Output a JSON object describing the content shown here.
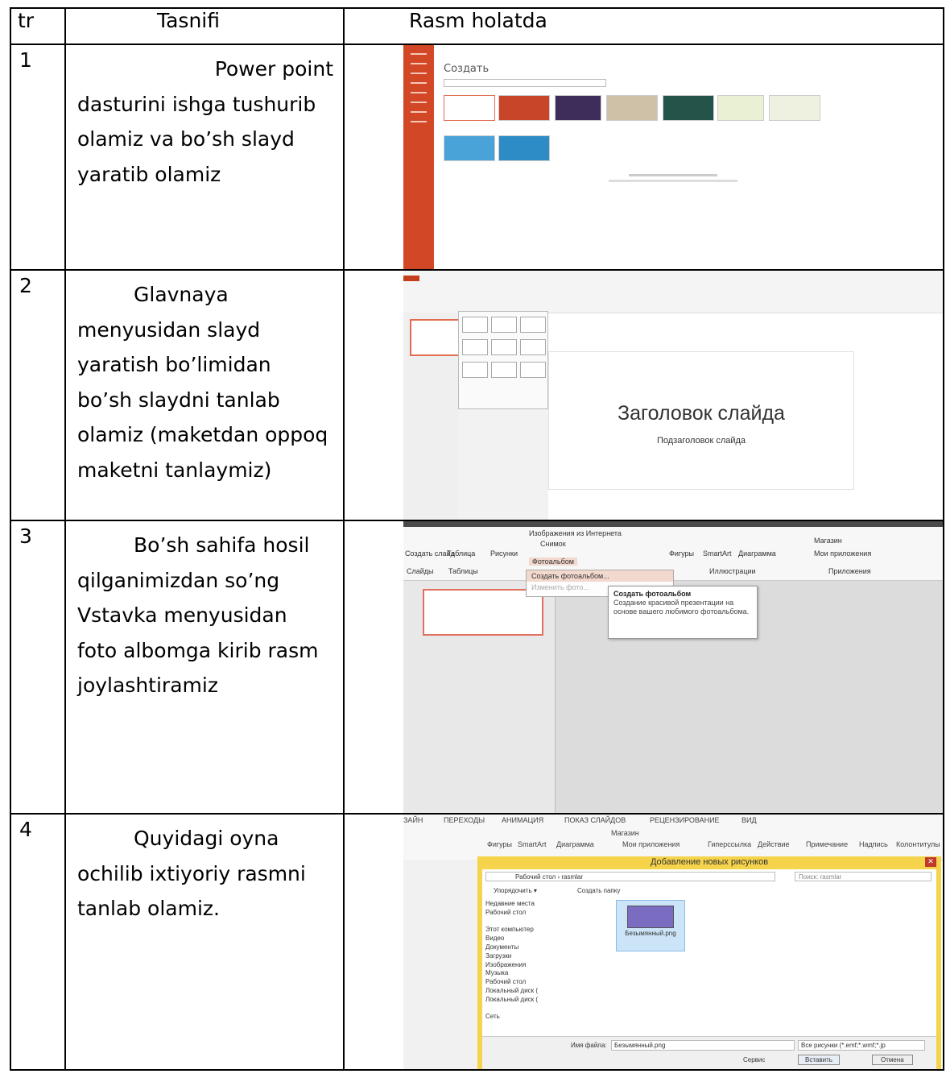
{
  "header": {
    "col_num": "tr",
    "col_desc": "Tasnifi",
    "col_pic": "Rasm holatda"
  },
  "rows": [
    {
      "num": "1",
      "lines": [
        "Power point",
        "dasturini ishga tushurib",
        "olamiz va bo’sh slayd",
        "yaratib olamiz"
      ]
    },
    {
      "num": "2",
      "lines": [
        "Glavnaya",
        "menyusidan slayd",
        "yaratish bo’limidan",
        "bo’sh slaydni tanlab",
        "olamiz (maketdan oppoq",
        "maketni tanlaymiz)"
      ]
    },
    {
      "num": "3",
      "lines": [
        "Bo’sh sahifa hosil",
        "qilganimizdan so’ng",
        "Vstavka menyusidan",
        "foto albomga kirib rasm",
        "joylashtiramiz"
      ]
    },
    {
      "num": "4",
      "lines": [
        "Quyidagi oyna",
        "ochilib ixtiyoriy rasmni",
        "tanlab olamiz."
      ]
    }
  ],
  "shots": {
    "s1": {
      "title": "Создать"
    },
    "s2": {
      "slide_title": "Заголовок слайда",
      "slide_subtitle": "Подзаголовок слайда"
    },
    "s3": {
      "ribbon": [
        "Изображения из Интернета",
        "Снимок",
        "Фотоальбом",
        "Фигуры",
        "SmartArt",
        "Диаграмма",
        "Магазин",
        "Мои приложения",
        "Создать слайд",
        "Таблица",
        "Рисунки",
        "Слайды",
        "Таблицы",
        "Иллюстрации",
        "Приложения"
      ],
      "menu": [
        "Создать фотоальбом...",
        "Изменить фото..."
      ],
      "tooltip_title": "Создать фотоальбом",
      "tooltip_text": "Создание красивой презентации на основе вашего любимого фотоальбома."
    },
    "s4": {
      "ribbon": [
        "ЗАЙН",
        "ПЕРЕХОДЫ",
        "АНИМАЦИЯ",
        "ПОКАЗ СЛАЙДОВ",
        "РЕЦЕНЗИРОВАНИЕ",
        "ВИД",
        "Фигуры",
        "SmartArt",
        "Диаграмма",
        "Магазин",
        "Мои приложения",
        "Гиперссылка",
        "Действие",
        "Примечание",
        "Надпись",
        "Колонтитулы"
      ],
      "caption": "Добавление новых рисунков",
      "address": "Рабочий стол › rasmlar",
      "search": "Поиск: rasmlar",
      "organize": "Упорядочить ▾",
      "new_folder": "Создать папку",
      "tree": [
        "Недавние места",
        "Рабочий стол",
        "",
        "Этот компьютер",
        "Видео",
        "Документы",
        "Загрузки",
        "Изображения",
        "Музыка",
        "Рабочий стол",
        "Локальный диск (",
        "Локальный диск (",
        "",
        "Сеть"
      ],
      "file_name": "Безымянный.png",
      "file_label": "Имя файла:",
      "file_value": "Безымянный.png",
      "filter": "Все рисунки (*.emf;*.wmf;*.jp",
      "service": "Сервис",
      "insert": "Вставить",
      "cancel": "Отмена"
    }
  }
}
